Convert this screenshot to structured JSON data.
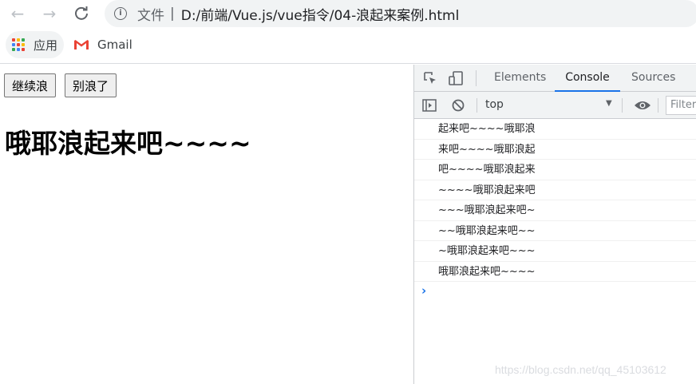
{
  "browser": {
    "file_label": "文件",
    "separator": "|",
    "url": "D:/前端/Vue.js/vue指令/04-浪起来案例.html"
  },
  "bookmarks": {
    "apps_label": "应用",
    "gmail_label": "Gmail"
  },
  "page": {
    "continue_button": "继续浪",
    "stop_button": "别浪了",
    "headline": "哦耶浪起来吧~~~~"
  },
  "devtools": {
    "tabs": [
      "Elements",
      "Console",
      "Sources"
    ],
    "active_tab": "Console",
    "context": "top",
    "filter_placeholder": "Filter",
    "console_lines": [
      "起来吧~~~~哦耶浪",
      "来吧~~~~哦耶浪起",
      "吧~~~~哦耶浪起来",
      "~~~~哦耶浪起来吧",
      "~~~哦耶浪起来吧~",
      "~~哦耶浪起来吧~~",
      "~哦耶浪起来吧~~~",
      "哦耶浪起来吧~~~~"
    ],
    "prompt_symbol": "›"
  },
  "watermark": "https://blog.csdn.net/qq_45103612",
  "colors": {
    "accent": "#1a73e8",
    "toolbar_bg": "#f1f3f4"
  }
}
